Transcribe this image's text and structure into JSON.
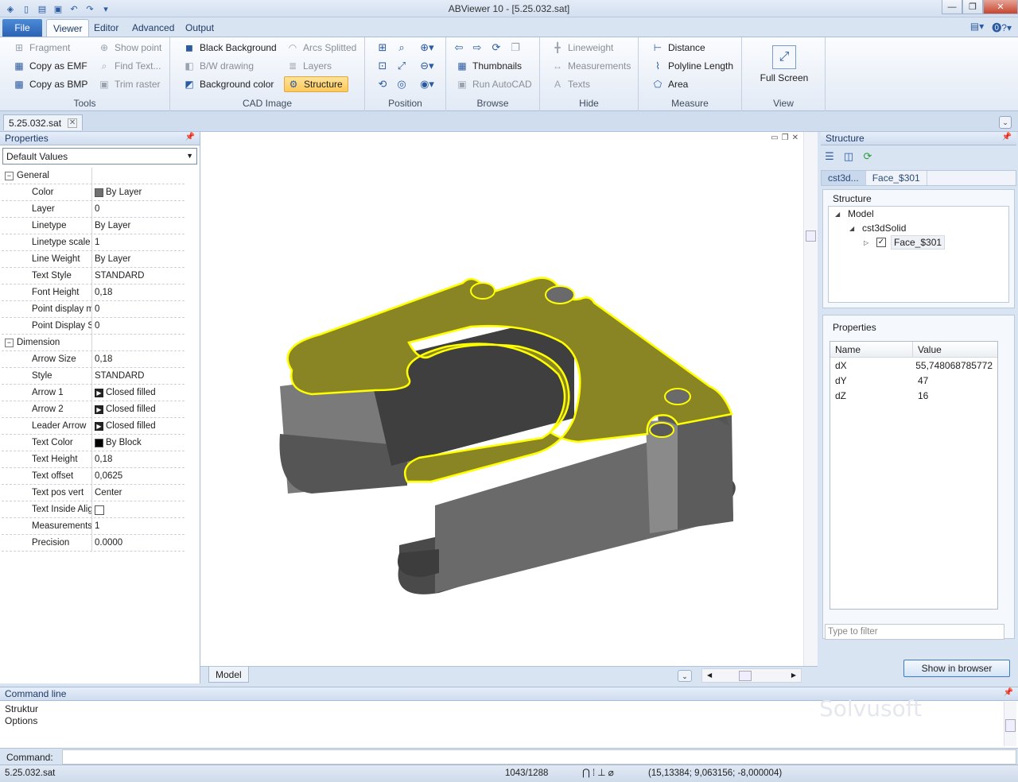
{
  "window": {
    "title": "ABViewer 10 - [5.25.032.sat]",
    "controls": {
      "minimize": "—",
      "maximize": "❐",
      "close": "✕"
    }
  },
  "quick_access": [
    "app-icon",
    "new-icon",
    "open-icon",
    "save-icon",
    "undo-icon",
    "redo-icon",
    "customize-icon"
  ],
  "ribbon_tabs": {
    "file": "File",
    "viewer": "Viewer",
    "editor": "Editor",
    "advanced": "Advanced",
    "output": "Output"
  },
  "ribbon_right": {
    "options": "▾",
    "help": "?▾"
  },
  "ribbon": {
    "tools": {
      "title": "Tools",
      "fragment": "Fragment",
      "copy_emf": "Copy as EMF",
      "copy_bmp": "Copy as BMP",
      "show_point": "Show point",
      "find_text": "Find Text...",
      "trim_raster": "Trim raster"
    },
    "cad_image": {
      "title": "CAD Image",
      "black_background": "Black Background",
      "bw_drawing": "B/W drawing",
      "background_color": "Background color",
      "arcs_splitted": "Arcs Splitted",
      "layers": "Layers",
      "structure": "Structure"
    },
    "position": {
      "title": "Position"
    },
    "browse": {
      "title": "Browse",
      "thumbnails": "Thumbnails",
      "run_autocad": "Run AutoCAD"
    },
    "hide": {
      "title": "Hide",
      "lineweight": "Lineweight",
      "measurements": "Measurements",
      "texts": "Texts"
    },
    "measure": {
      "title": "Measure",
      "distance": "Distance",
      "polyline_length": "Polyline Length",
      "area": "Area"
    },
    "view": {
      "title": "View",
      "full_screen": "Full Screen"
    }
  },
  "document_tab": {
    "name": "5.25.032.sat",
    "close": "✕"
  },
  "properties_panel": {
    "title": "Properties",
    "combo_value": "Default Values",
    "categories": [
      {
        "name": "General",
        "rows": [
          {
            "name": "Color",
            "value": "By Layer",
            "swatch": "#707070"
          },
          {
            "name": "Layer",
            "value": "0"
          },
          {
            "name": "Linetype",
            "value": "By Layer"
          },
          {
            "name": "Linetype scale",
            "value": "1"
          },
          {
            "name": "Line Weight",
            "value": "By Layer"
          },
          {
            "name": "Text Style",
            "value": "STANDARD"
          },
          {
            "name": "Font Height",
            "value": "0,18"
          },
          {
            "name": "Point display m",
            "value": "0"
          },
          {
            "name": "Point Display Si",
            "value": "0"
          }
        ]
      },
      {
        "name": "Dimension",
        "rows": [
          {
            "name": "Arrow Size",
            "value": "0,18"
          },
          {
            "name": "Style",
            "value": "STANDARD"
          },
          {
            "name": "Arrow 1",
            "value": "Closed filled",
            "icon": "arrow"
          },
          {
            "name": "Arrow 2",
            "value": "Closed filled",
            "icon": "arrow"
          },
          {
            "name": "Leader Arrow",
            "value": "Closed filled",
            "icon": "arrow"
          },
          {
            "name": "Text Color",
            "value": "By Block",
            "swatch": "#000000"
          },
          {
            "name": "Text Height",
            "value": "0,18"
          },
          {
            "name": "Text offset",
            "value": "0,0625"
          },
          {
            "name": "Text pos vert",
            "value": "Center"
          },
          {
            "name": "Text Inside Alig",
            "value": "",
            "checkbox": true
          },
          {
            "name": "Measurements",
            "value": "1"
          },
          {
            "name": "Precision",
            "value": "0.0000"
          }
        ]
      }
    ]
  },
  "canvas": {
    "model_tab": "Model",
    "colors": {
      "body": "#5e5e5e",
      "face": "#8a8524",
      "outline": "#ffff00"
    }
  },
  "structure_panel": {
    "title": "Structure",
    "breadcrumbs": [
      "cst3d...",
      "Face_$301"
    ],
    "tree_title": "Structure",
    "tree": [
      {
        "label": "Model",
        "level": 0,
        "expander": "◢"
      },
      {
        "label": "cst3dSolid",
        "level": 1,
        "expander": "◢"
      },
      {
        "label": "Face_$301",
        "level": 2,
        "expander": "▷",
        "checked": true
      }
    ],
    "props_title": "Properties",
    "table_headers": {
      "name": "Name",
      "value": "Value"
    },
    "table_rows": [
      {
        "name": "dX",
        "value": "55,748068785772"
      },
      {
        "name": "dY",
        "value": "47"
      },
      {
        "name": "dZ",
        "value": "16"
      }
    ],
    "filter_placeholder": "Type to filter",
    "show_in_browser": "Show in browser"
  },
  "command_line": {
    "title": "Command line",
    "history": [
      "Struktur",
      "Options"
    ],
    "input_label": "Command:",
    "watermark": "Solvusoft"
  },
  "status_bar": {
    "file": "5.25.032.sat",
    "page": "1043/1288",
    "coords": "(15,13384; 9,063156; -8,000004)"
  }
}
